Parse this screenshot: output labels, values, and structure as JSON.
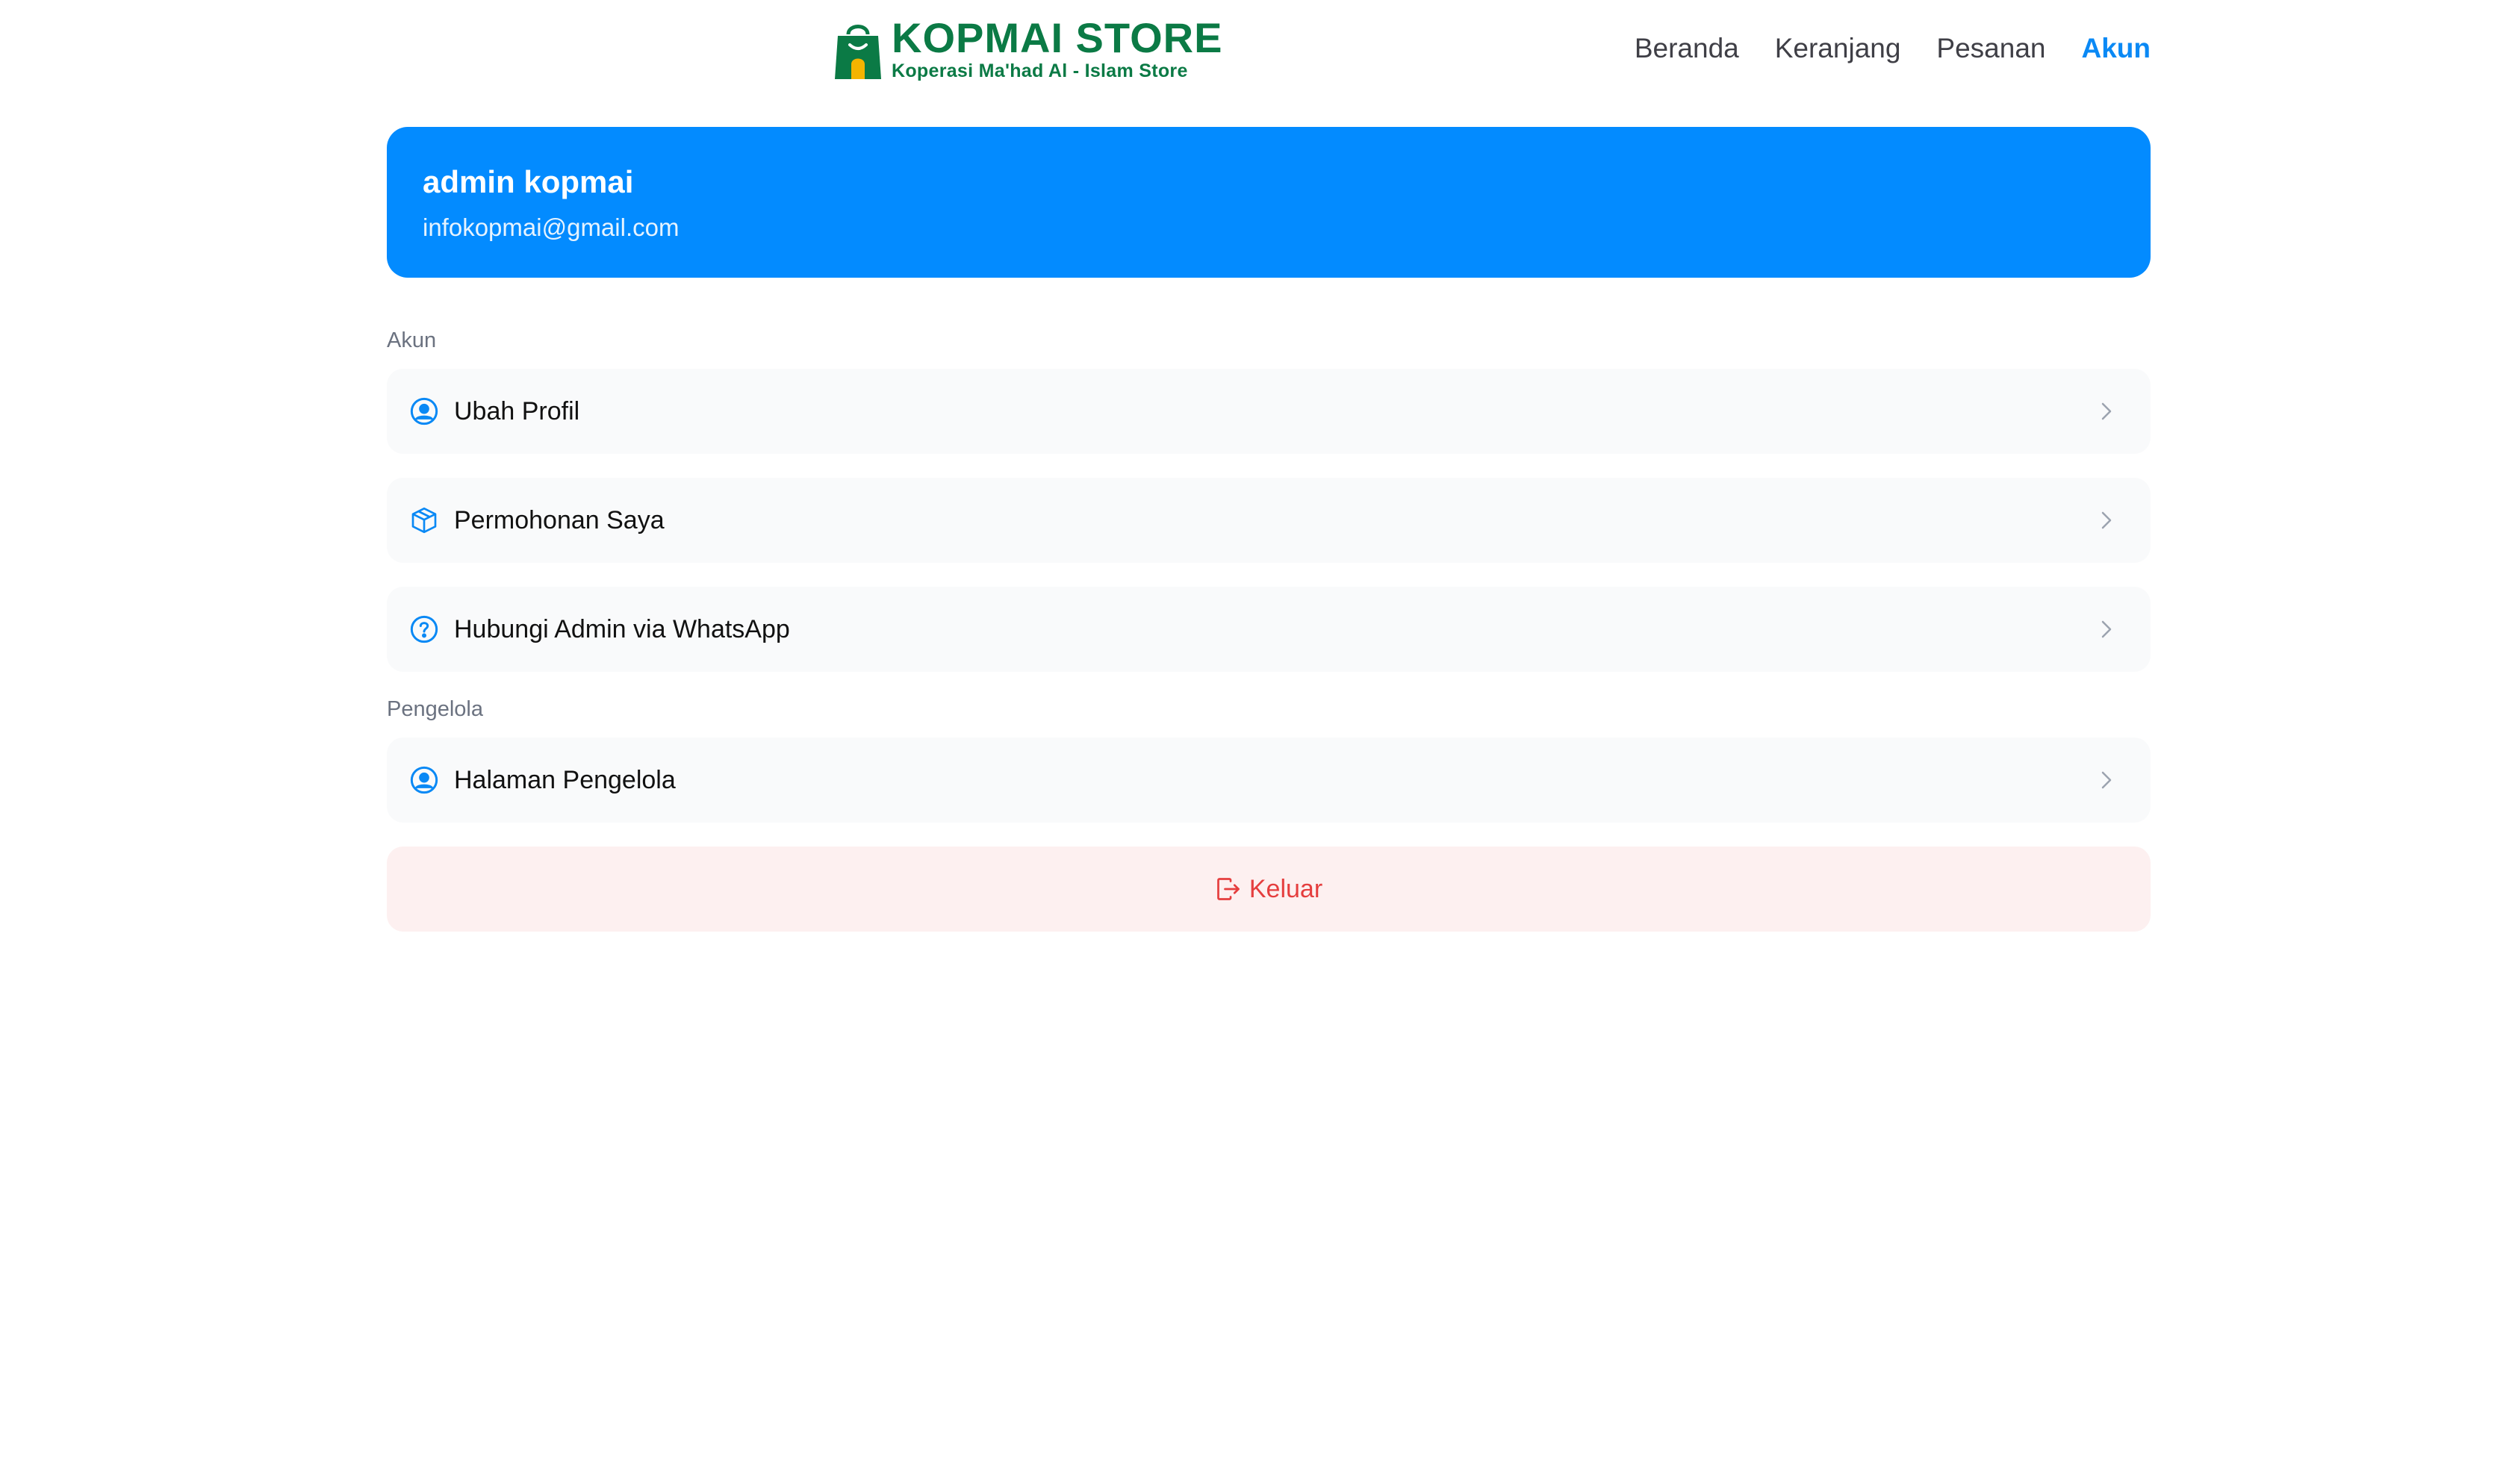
{
  "brand": {
    "title": "KOPMAI STORE",
    "subtitle": "Koperasi Ma'had Al - Islam Store",
    "color": "#0b7a45"
  },
  "nav": {
    "items": [
      {
        "label": "Beranda",
        "active": false
      },
      {
        "label": "Keranjang",
        "active": false
      },
      {
        "label": "Pesanan",
        "active": false
      },
      {
        "label": "Akun",
        "active": true
      }
    ],
    "active_color": "#0a89f5"
  },
  "profile": {
    "name": "admin kopmai",
    "email": "infokopmai@gmail.com",
    "card_color": "#038bff"
  },
  "sections": {
    "account": {
      "label": "Akun",
      "items": [
        {
          "label": "Ubah Profil",
          "icon": "user-circle-icon"
        },
        {
          "label": "Permohonan Saya",
          "icon": "package-icon"
        },
        {
          "label": "Hubungi Admin via WhatsApp",
          "icon": "question-circle-icon"
        }
      ]
    },
    "manager": {
      "label": "Pengelola",
      "items": [
        {
          "label": "Halaman Pengelola",
          "icon": "user-circle-icon"
        }
      ]
    }
  },
  "logout": {
    "label": "Keluar",
    "icon": "logout-icon",
    "color": "#e53e3e"
  }
}
